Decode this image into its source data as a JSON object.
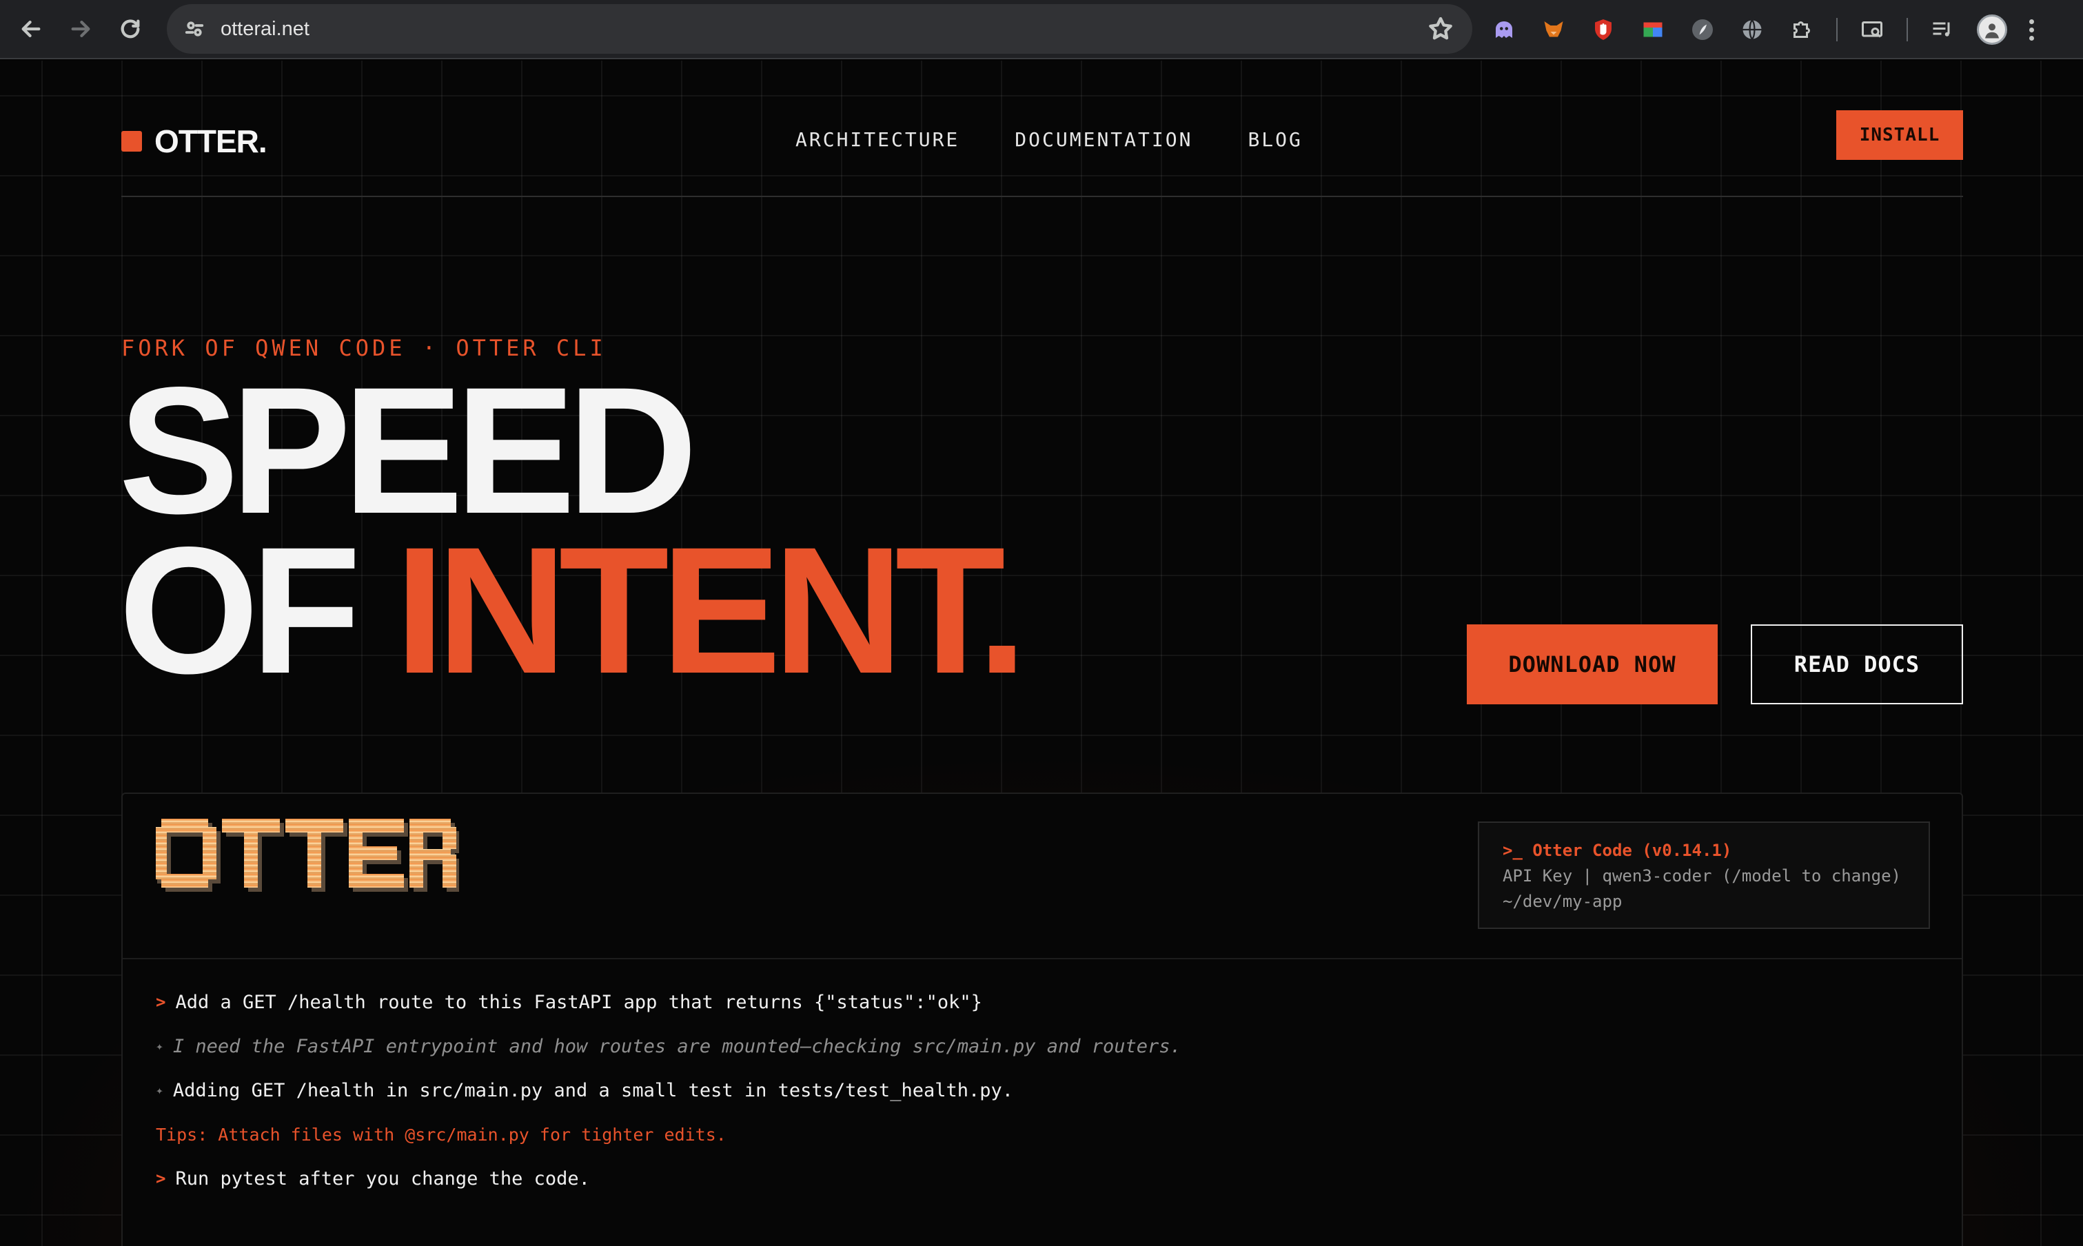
{
  "browser": {
    "url": "otterai.net",
    "back_icon": "arrow-left-icon",
    "forward_icon": "arrow-right-icon",
    "reload_icon": "reload-icon",
    "extensions": [
      "ghost-extension-icon",
      "fox-extension-icon",
      "shield-extension-icon",
      "palette-extension-icon",
      "feather-extension-icon",
      "globe-extension-icon",
      "puzzle-extension-icon"
    ]
  },
  "site": {
    "logo": "OTTER.",
    "nav": [
      "ARCHITECTURE",
      "DOCUMENTATION",
      "BLOG"
    ],
    "install_label": "INSTALL"
  },
  "hero": {
    "kicker": "FORK OF QWEN CODE · OTTER CLI",
    "headline_line1": "SPEED",
    "headline_of": "OF",
    "headline_accent": "INTENT.",
    "download_label": "DOWNLOAD NOW",
    "docs_label": "READ DOCS"
  },
  "terminal": {
    "ascii_logo": "OTTER",
    "info_title": ">_ Otter Code (v0.14.1)",
    "info_line1": "API Key | qwen3-coder (/model to change)",
    "info_line2": "~/dev/my-app",
    "lines": [
      {
        "kind": "prompt",
        "marker": ">",
        "text": "Add a GET /health route to this FastAPI app that returns {\"status\":\"ok\"}"
      },
      {
        "kind": "thought",
        "marker": "✦",
        "text": "I need the FastAPI entrypoint and how routes are mounted—checking src/main.py and routers."
      },
      {
        "kind": "answer",
        "marker": "✦",
        "text": "Adding GET /health in src/main.py and a small test in tests/test_health.py."
      },
      {
        "kind": "tip",
        "marker": "",
        "text": "Tips: Attach files with @src/main.py for tighter edits."
      },
      {
        "kind": "prompt",
        "marker": ">",
        "text": "Run pytest after you change the code."
      }
    ]
  },
  "colors": {
    "accent": "#e8532b",
    "background": "#060606",
    "text": "#f2f2f2"
  }
}
